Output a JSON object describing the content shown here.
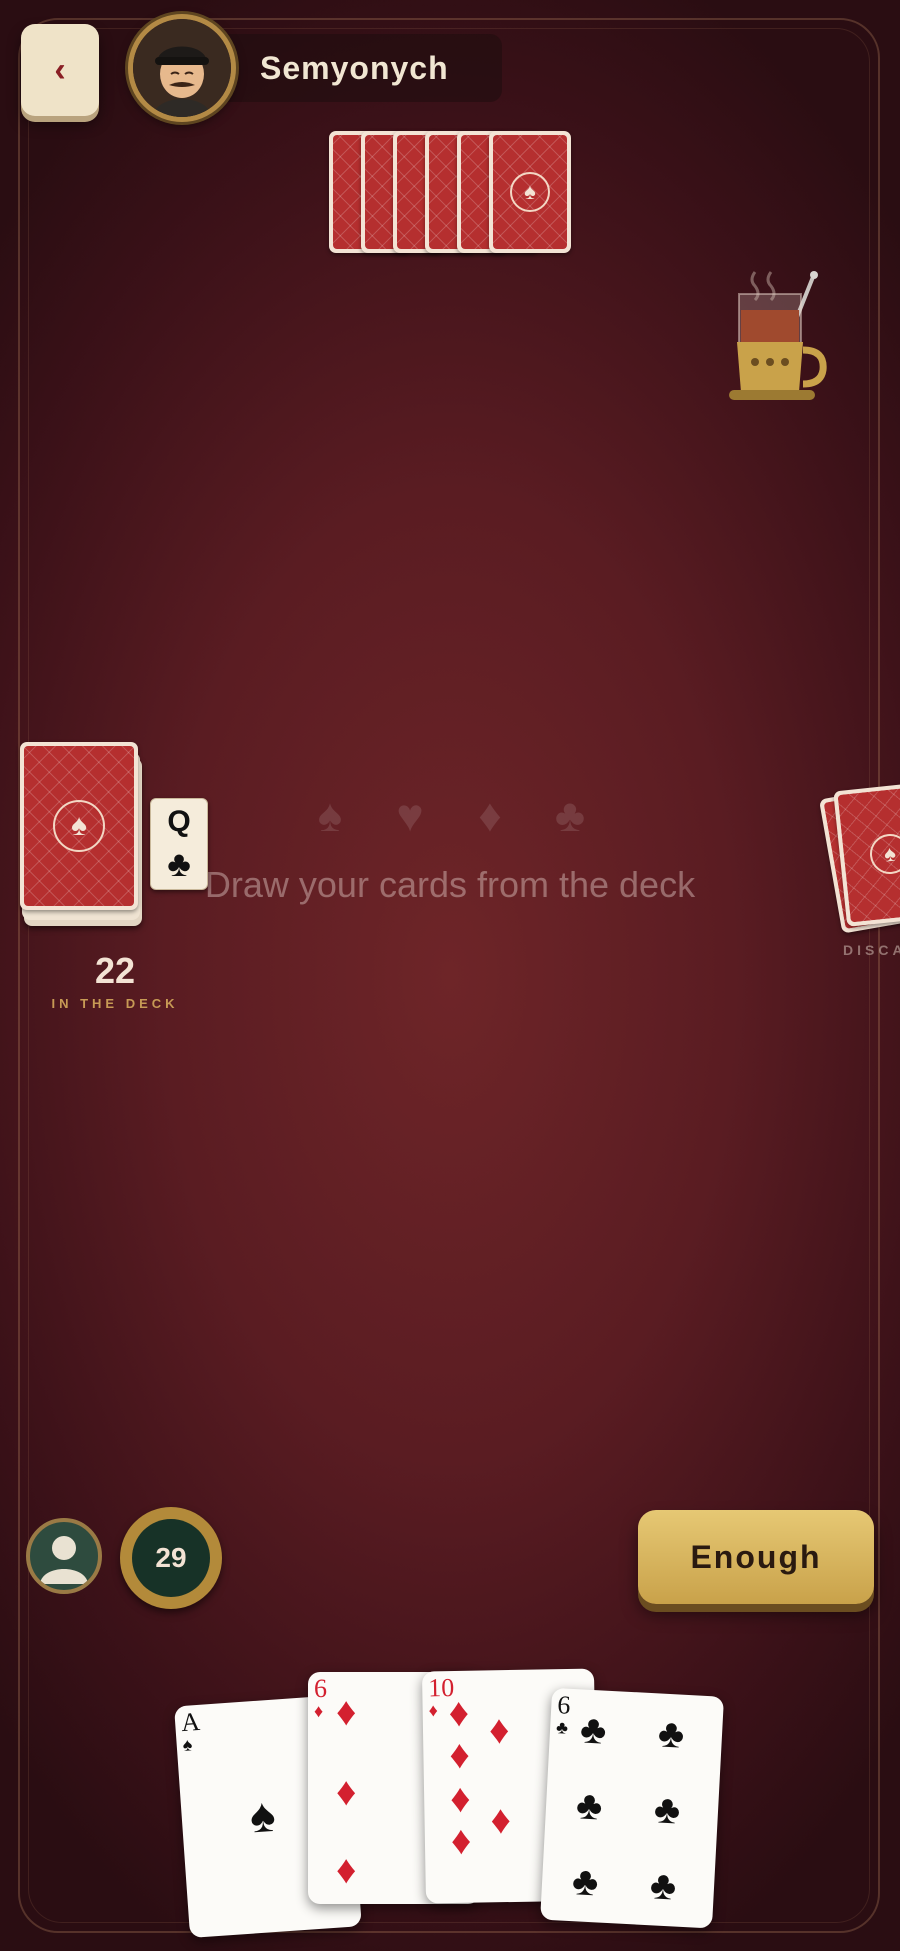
{
  "header": {
    "back_icon": "chevron-left-icon",
    "opponent_name": "Semyonych"
  },
  "table": {
    "opponent_hand_count": 6,
    "suits": [
      "♠",
      "♥",
      "♦",
      "♣"
    ],
    "prompt": "Draw your cards from the deck",
    "deck_count": "22",
    "deck_label": "IN THE DECK",
    "trump_card": {
      "rank": "Q",
      "suit": "♣"
    },
    "discard_label": "DISCARD"
  },
  "player": {
    "timer": "29",
    "enough_label": "Enough"
  },
  "hand": [
    {
      "rank": "A",
      "suit": "♠",
      "color": "black"
    },
    {
      "rank": "6",
      "suit": "♦",
      "color": "red"
    },
    {
      "rank": "10",
      "suit": "♦",
      "color": "red"
    },
    {
      "rank": "6",
      "suit": "♣",
      "color": "black"
    }
  ],
  "colors": {
    "felt": "#5a1c22",
    "card_back": "#b52f2f",
    "gold": "#c9a24a",
    "timer_bg": "#173227"
  }
}
